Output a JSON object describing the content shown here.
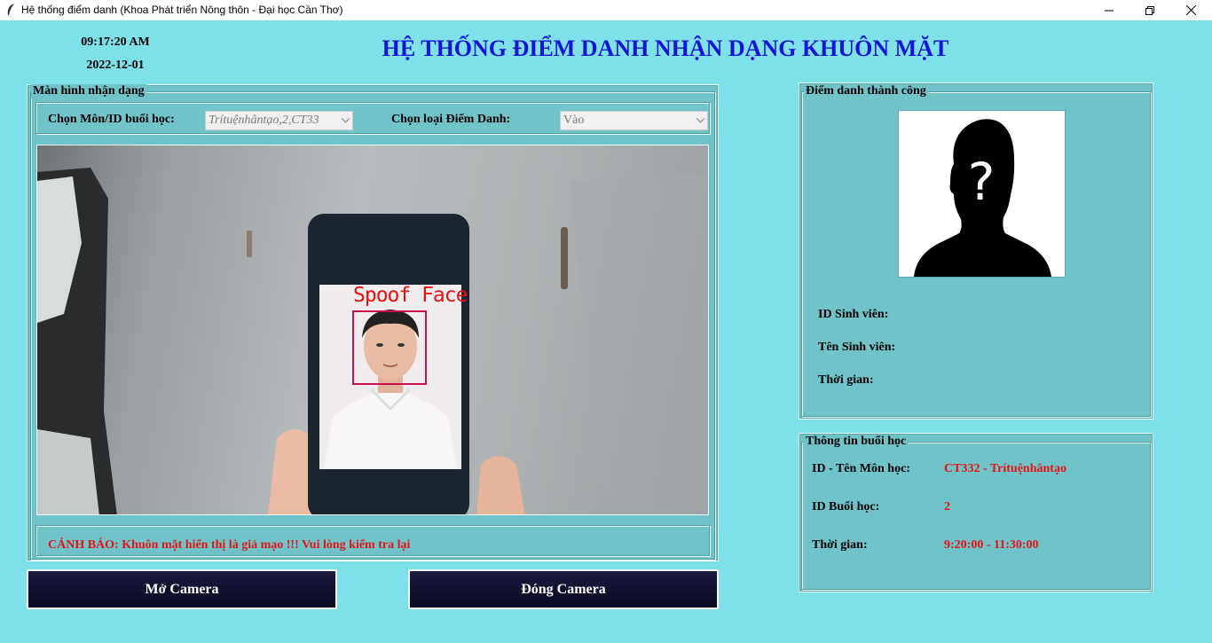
{
  "window": {
    "title": "Hệ thống điểm danh (Khoa Phát triển Nông thôn - Đại học Cần Thơ)",
    "controls": [
      "minimize-icon",
      "maximize-icon",
      "close-icon"
    ]
  },
  "clock": {
    "time": "09:17:20 AM",
    "date": "2022-12-01"
  },
  "header": {
    "title": "HỆ THỐNG ĐIỂM DANH NHẬN DẠNG KHUÔN MẶT"
  },
  "recognition_panel": {
    "legend": "Màn hình nhận dạng",
    "subject_label": "Chọn Môn/ID buổi học:",
    "subject_value": "Trítuệnhântạo,2,CT33",
    "type_label": "Chọn loại Điểm Danh:",
    "type_value": "Vào",
    "detection_label": "Spoof Face",
    "warning": "CẢNH BÁO: Khuôn mặt hiển thị là giả mạo !!! Vui lòng kiểm tra lại"
  },
  "buttons": {
    "open_camera": "Mở Camera",
    "close_camera": "Đóng Camera"
  },
  "success_panel": {
    "legend": "Điểm danh thành công",
    "student_id_label": "ID Sinh viên:",
    "student_name_label": "Tên Sinh viên:",
    "time_label": "Thời gian:"
  },
  "session_panel": {
    "legend": "Thông tin buổi học",
    "subject_label": "ID - Tên Môn học:",
    "subject_value": "CT332 - Trítuệnhântạo",
    "session_label": "ID Buổi học:",
    "session_value": "2",
    "time_label": "Thời gian:",
    "time_value": "9:20:00 - 11:30:00"
  },
  "colors": {
    "background": "#7ee1e9",
    "panel": "#6fc3c9",
    "title": "#1414d8",
    "alert": "#e41414",
    "button": "#14122f"
  }
}
